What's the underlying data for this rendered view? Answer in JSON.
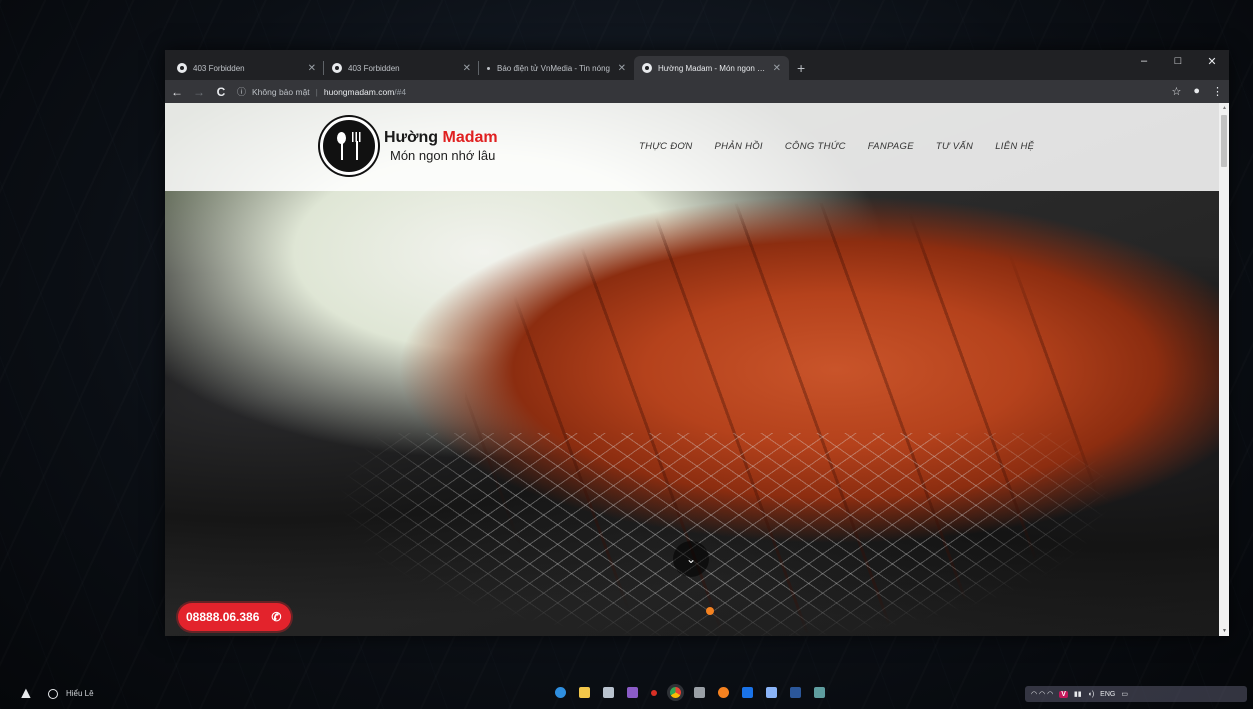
{
  "browser": {
    "tabs": [
      {
        "title": "403 Forbidden",
        "active": false
      },
      {
        "title": "403 Forbidden",
        "active": false
      },
      {
        "title": "Báo điện tử VnMedia - Tin nóng",
        "active": false
      },
      {
        "title": "Hường Madam - Món ngon nhớ lâu",
        "active": true
      }
    ],
    "new_tab_label": "+",
    "window_controls": {
      "minimize": "–",
      "maximize": "□",
      "close": "✕"
    },
    "nav": {
      "back": "←",
      "forward": "→",
      "reload": "C"
    },
    "omnibox": {
      "info": "ⓘ",
      "security_text": "Không bảo mật",
      "divider": "|",
      "host": "huongmadam.com",
      "path": "/#4"
    },
    "star": "☆",
    "profile": "●",
    "menu": "⋮"
  },
  "site": {
    "brand_prefix": "Hường ",
    "brand_highlight": "Madam",
    "tagline": "Món ngon nhớ lâu",
    "menu": [
      "THỰC ĐƠN",
      "PHẢN HỒI",
      "CÔNG THỨC",
      "FANPAGE",
      "TƯ VẤN",
      "LIÊN HỆ"
    ],
    "scroll_down_glyph": "⌄",
    "phone_number": "08888.06.386",
    "phone_glyph": "✆",
    "accent_red": "#e02020",
    "dot_orange": "#f58220"
  },
  "taskbar": {
    "user_name": "Hiểu Lê",
    "tray_text": "ENG",
    "tray_v": "V"
  }
}
